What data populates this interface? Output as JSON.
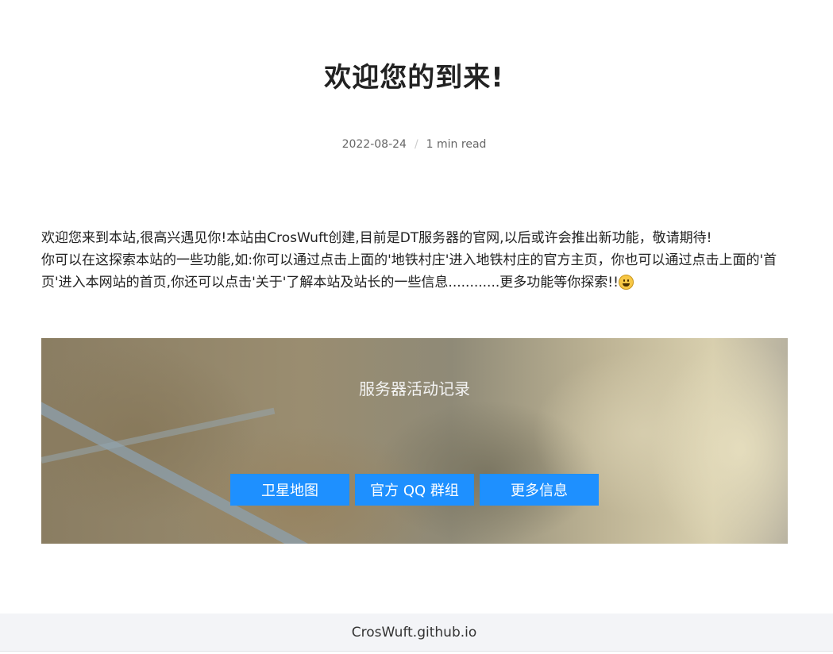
{
  "post": {
    "title": "欢迎您的到来!",
    "date": "2022-08-24",
    "meta_separator": "/",
    "read_time": "1 min read",
    "body_line_1": "欢迎您来到本站,很高兴遇见你!本站由CrosWuft创建,目前是DT服务器的官网,以后或许会推出新功能，敬请期待!",
    "body_line_2": "你可以在这探索本站的一些功能,如:你可以通过点击上面的'地铁村庄'进入地铁村庄的官方主页，你也可以通过点击上面的'首页'进入本网站的首页,你还可以点击'关于'了解本站及站长的一些信息............更多功能等你探索!!",
    "emoji_icon": "grinning-face-emoji"
  },
  "banner": {
    "title": "服务器活动记录",
    "buttons": [
      {
        "label": "卫星地图"
      },
      {
        "label": "官方 QQ 群组"
      },
      {
        "label": "更多信息"
      }
    ],
    "button_color": "#1e90ff"
  },
  "footer": {
    "link_text": "CrosWuft.github.io"
  }
}
